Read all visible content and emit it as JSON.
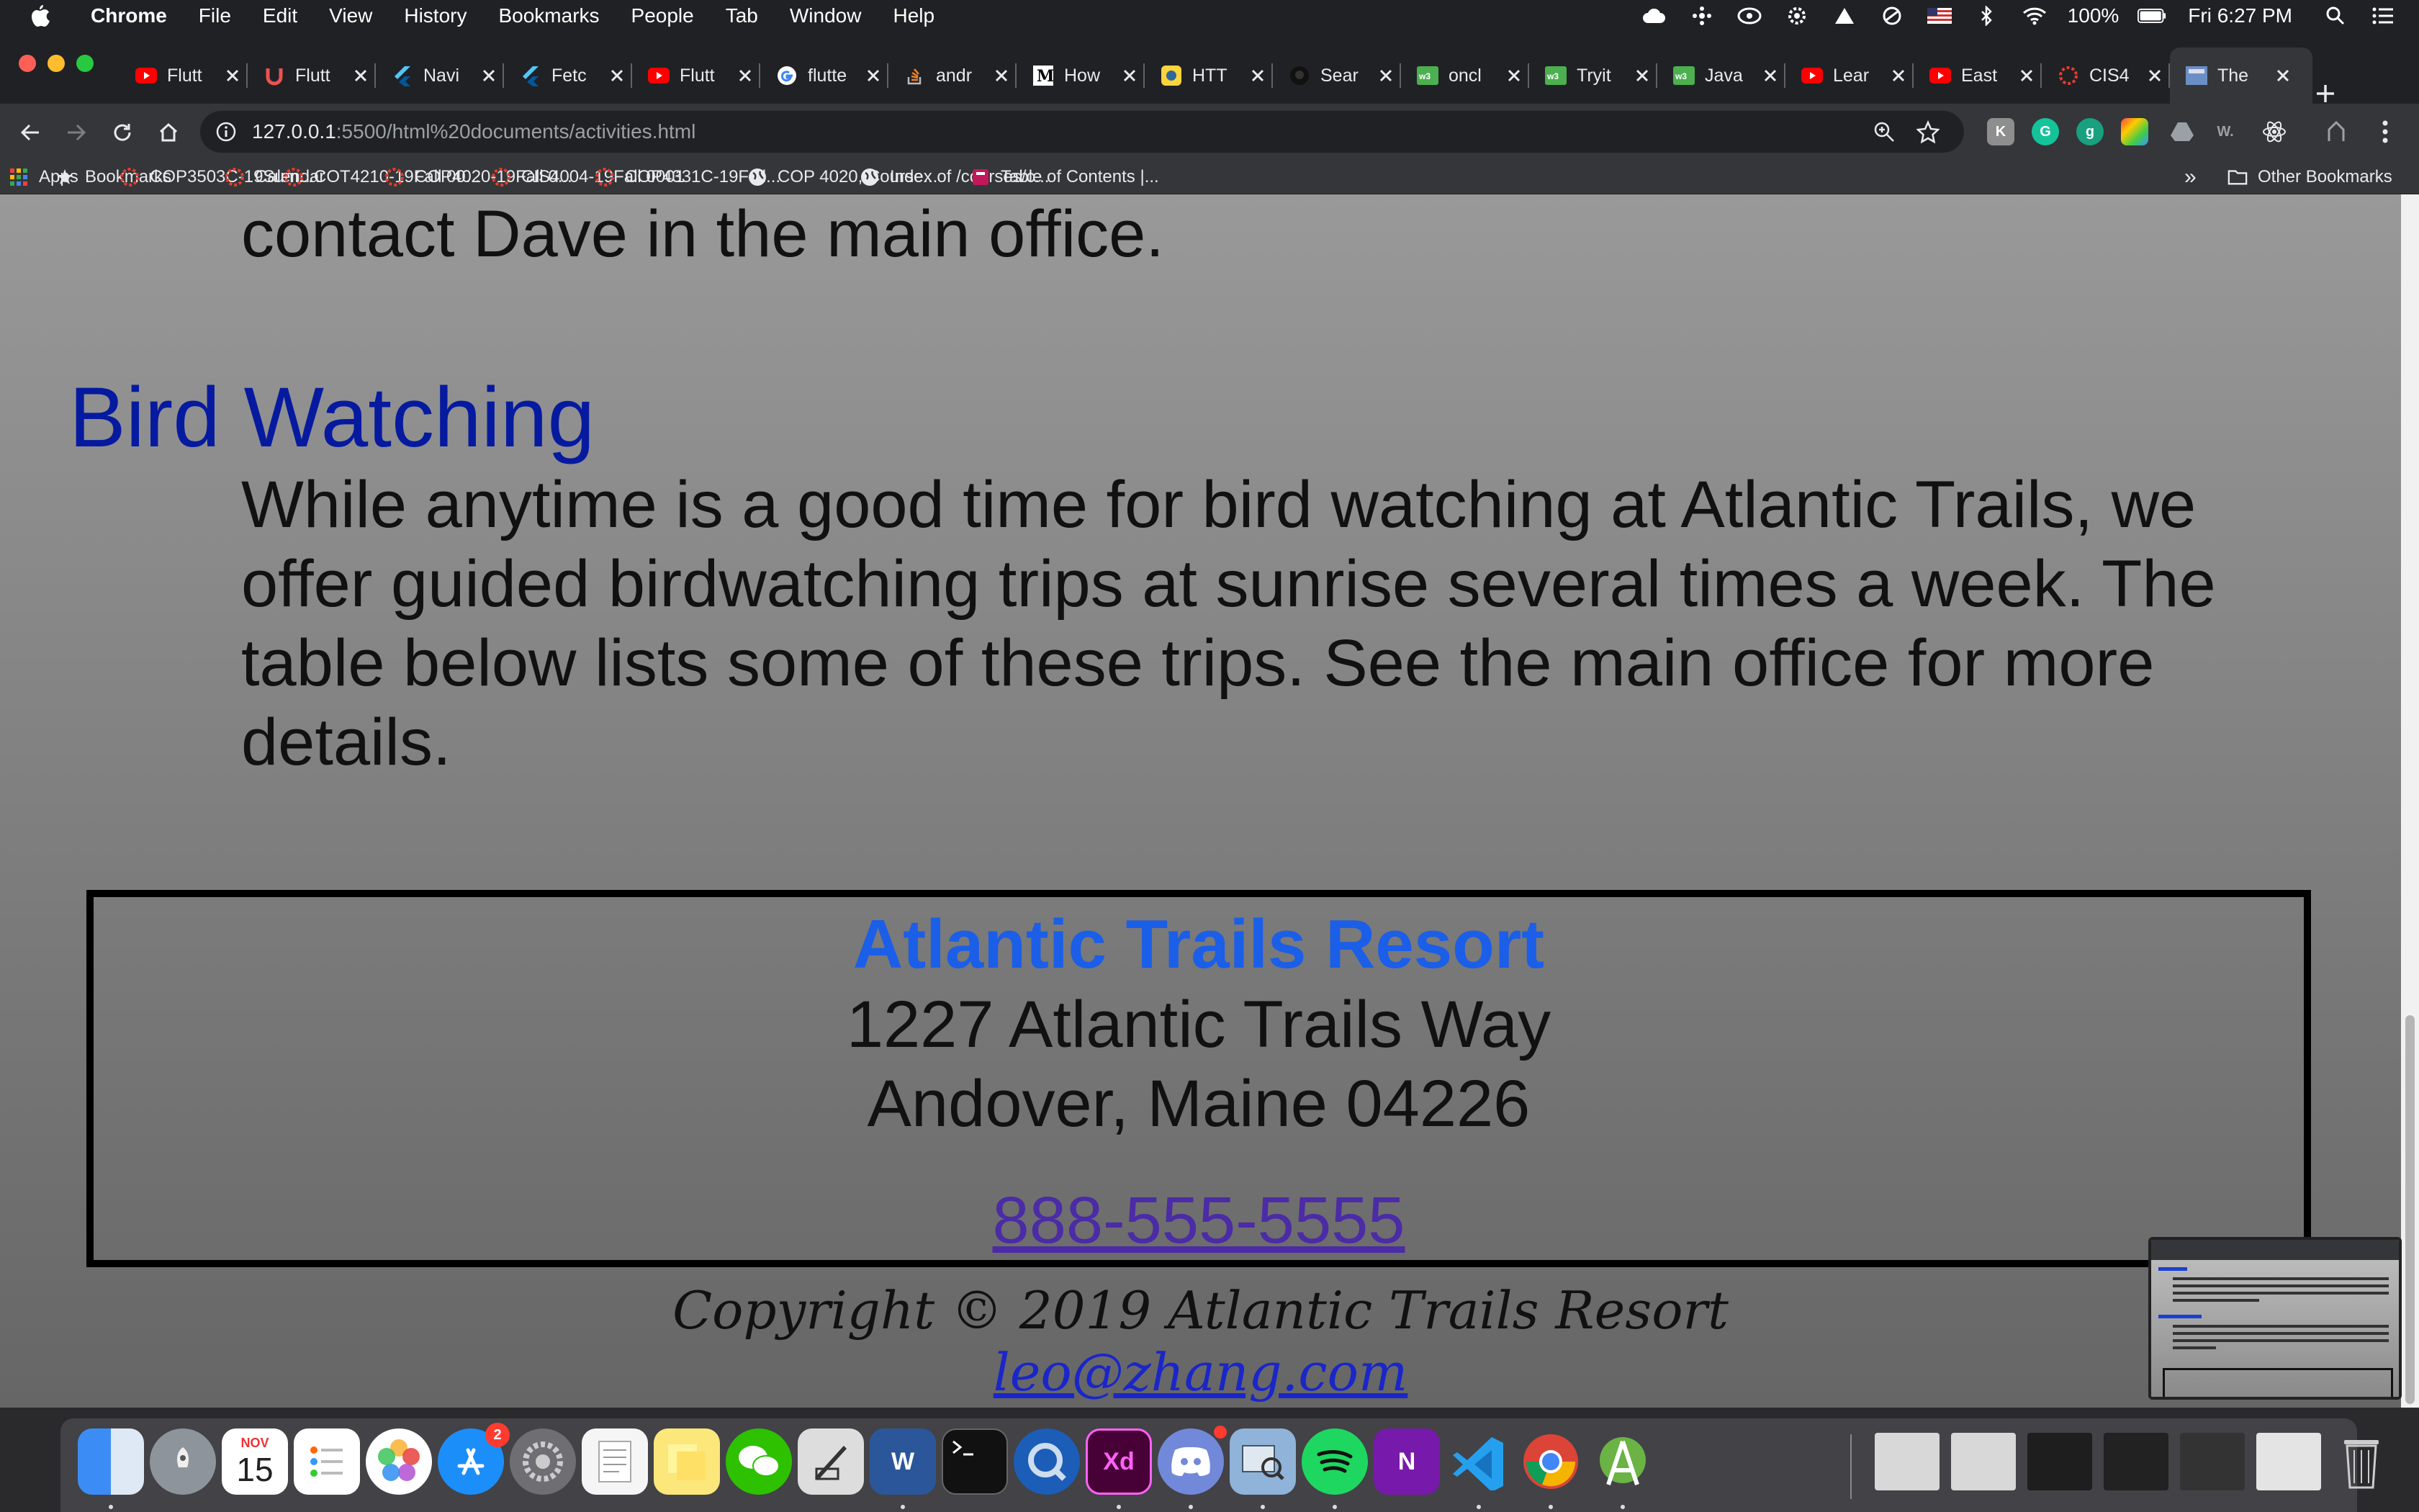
{
  "menubar": {
    "app_name": "Chrome",
    "items": [
      "File",
      "Edit",
      "View",
      "History",
      "Bookmarks",
      "People",
      "Tab",
      "Window",
      "Help"
    ],
    "battery": "100%",
    "clock": "Fri 6:27 PM"
  },
  "tabs": [
    {
      "label": "Flutt",
      "icon": "youtube-icon"
    },
    {
      "label": "Flutt",
      "icon": "udemy-icon"
    },
    {
      "label": "Navi",
      "icon": "flutter-icon"
    },
    {
      "label": "Fetc",
      "icon": "flutter-icon"
    },
    {
      "label": "Flutt",
      "icon": "youtube-icon"
    },
    {
      "label": "flutte",
      "icon": "google-icon"
    },
    {
      "label": "andr",
      "icon": "stackoverflow-icon"
    },
    {
      "label": "How",
      "icon": "medium-icon"
    },
    {
      "label": "HTT",
      "icon": "pythonorg-icon"
    },
    {
      "label": "Sear",
      "icon": "github-icon"
    },
    {
      "label": "oncl",
      "icon": "w3schools-icon"
    },
    {
      "label": "Tryit",
      "icon": "w3schools-icon"
    },
    {
      "label": "Java",
      "icon": "w3schools-icon"
    },
    {
      "label": "Lear",
      "icon": "youtube-icon"
    },
    {
      "label": "East",
      "icon": "youtube-icon"
    },
    {
      "label": "CIS4",
      "icon": "webcourses-icon"
    },
    {
      "label": "The",
      "icon": "page-icon"
    }
  ],
  "address_bar": {
    "url_host": "127.0.0.1",
    "url_rest": ":5500/html%20documents/activities.html"
  },
  "bookmarks": [
    {
      "label": "Apps",
      "icon": "apps-grid-icon"
    },
    {
      "label": "Bookmarks",
      "icon": "star-icon"
    },
    {
      "label": "COP3503C-19Sum...",
      "icon": "webcourses-icon"
    },
    {
      "label": "Calendar",
      "icon": "webcourses-icon"
    },
    {
      "label": "COT4210-19Fall 00...",
      "icon": "webcourses-icon"
    },
    {
      "label": "COP4020-19Fall 0...",
      "icon": "webcourses-icon"
    },
    {
      "label": "CIS4004-19Fall 0001",
      "icon": "webcourses-icon"
    },
    {
      "label": "COP4331C-19Fall...",
      "icon": "webcourses-icon"
    },
    {
      "label": "COP 4020, Course...",
      "icon": "globe-icon"
    },
    {
      "label": "Index of /courses/c...",
      "icon": "globe-icon"
    },
    {
      "label": "Table of Contents |...",
      "icon": "book-icon"
    }
  ],
  "bookmarks_overflow": "»",
  "other_bookmarks": "Other Bookmarks",
  "page": {
    "prev_line": "contact Dave in the main office.",
    "heading": "Bird Watching",
    "paragraph_lines": [
      "While anytime is a good time for bird watching at Atlantic Trails, we",
      "offer guided birdwatching trips at sunrise several times a week. The",
      "table below lists some of these trips. See the main office for more",
      "details."
    ],
    "resort_name": "Atlantic Trails Resort",
    "address_line1": "1227 Atlantic Trails Way",
    "address_line2": "Andover, Maine 04226",
    "phone": "888-555-5555",
    "copyright": "Copyright © 2019 Atlantic Trails Resort",
    "email": "leo@zhang.com"
  },
  "dock": {
    "calendar_month": "NOV",
    "calendar_day": "15",
    "appstore_badge": "2",
    "xd_label": "Xd",
    "word_label": "W",
    "onenote_label": "N"
  },
  "colors": {
    "heading": "#061aa0",
    "resort_name": "#1b5ee8",
    "phone_link": "#4b2ba6",
    "email_link": "#1a26c8"
  }
}
